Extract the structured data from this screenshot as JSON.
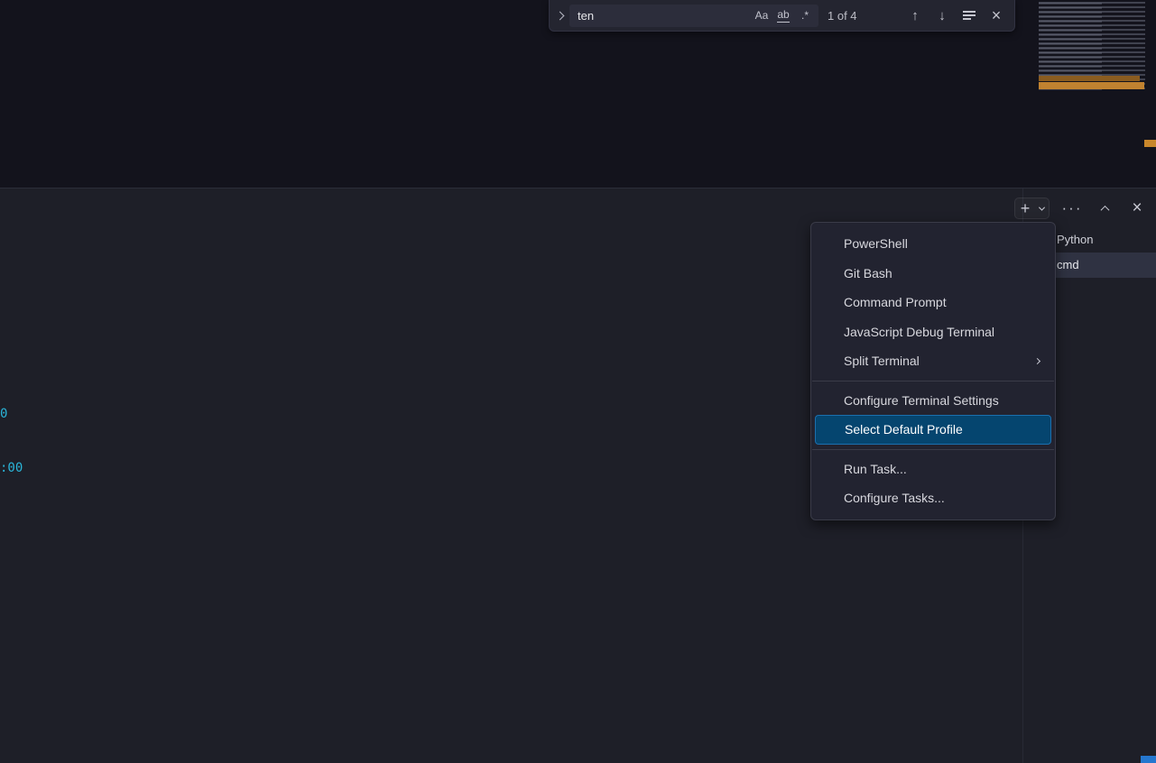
{
  "colors": {
    "menu_selection_blue": "#05456f",
    "search_highlight_orange": "#c08230",
    "terminal_cyan": "#2ab5d9",
    "scrollbar_blue": "#2577cf"
  },
  "find_widget": {
    "query": "ten",
    "results_count": "1 of 4",
    "match_case_label": "Aa",
    "whole_word_label": "ab",
    "regex_label": ".*",
    "prev_icon": "↑",
    "next_icon": "↓",
    "close_icon": "×"
  },
  "panel": {
    "toolbar": {
      "new_terminal_label": "+",
      "more_actions_label": "···",
      "close_label": "×"
    },
    "terminal_output": [
      {
        "text": "0"
      },
      {
        "text": ":00"
      }
    ],
    "tabs": [
      {
        "label": "Python",
        "selected": false
      },
      {
        "label": "cmd",
        "selected": true
      }
    ]
  },
  "context_menu": {
    "items": [
      {
        "label": "PowerShell"
      },
      {
        "label": "Git Bash"
      },
      {
        "label": "Command Prompt"
      },
      {
        "label": "JavaScript Debug Terminal"
      },
      {
        "label": "Split Terminal",
        "submenu": true
      },
      {
        "label": "Configure Terminal Settings"
      },
      {
        "label": "Select Default Profile",
        "selected": true
      },
      {
        "label": "Run Task..."
      },
      {
        "label": "Configure Tasks..."
      }
    ]
  }
}
